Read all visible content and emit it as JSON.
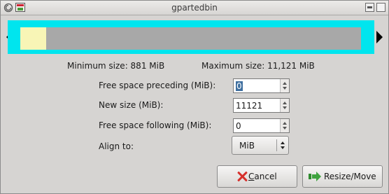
{
  "window": {
    "title": "gpartedbin"
  },
  "info": {
    "min_size": "Minimum size: 881 MiB",
    "max_size": "Maximum size: 11,121 MiB"
  },
  "partition_visual": {
    "used_fraction": 0.076,
    "frame_color": "#00e5ee",
    "used_color": "#f8f5b6",
    "unused_color": "#a8a8a8"
  },
  "form": {
    "free_preceding": {
      "label": "Free space preceding (MiB):",
      "value": "0"
    },
    "new_size": {
      "label": "New size (MiB):",
      "value": "11121"
    },
    "free_following": {
      "label": "Free space following (MiB):",
      "value": "0"
    },
    "align_to": {
      "label": "Align to:",
      "value": "MiB"
    }
  },
  "buttons": {
    "cancel_prefix": "C",
    "cancel_rest": "ancel",
    "resize": "Resize/Move"
  },
  "icons": [
    "menu-icon",
    "app-icon",
    "minimize-icon",
    "maximize-icon",
    "cancel-icon",
    "resize-move-icon"
  ]
}
